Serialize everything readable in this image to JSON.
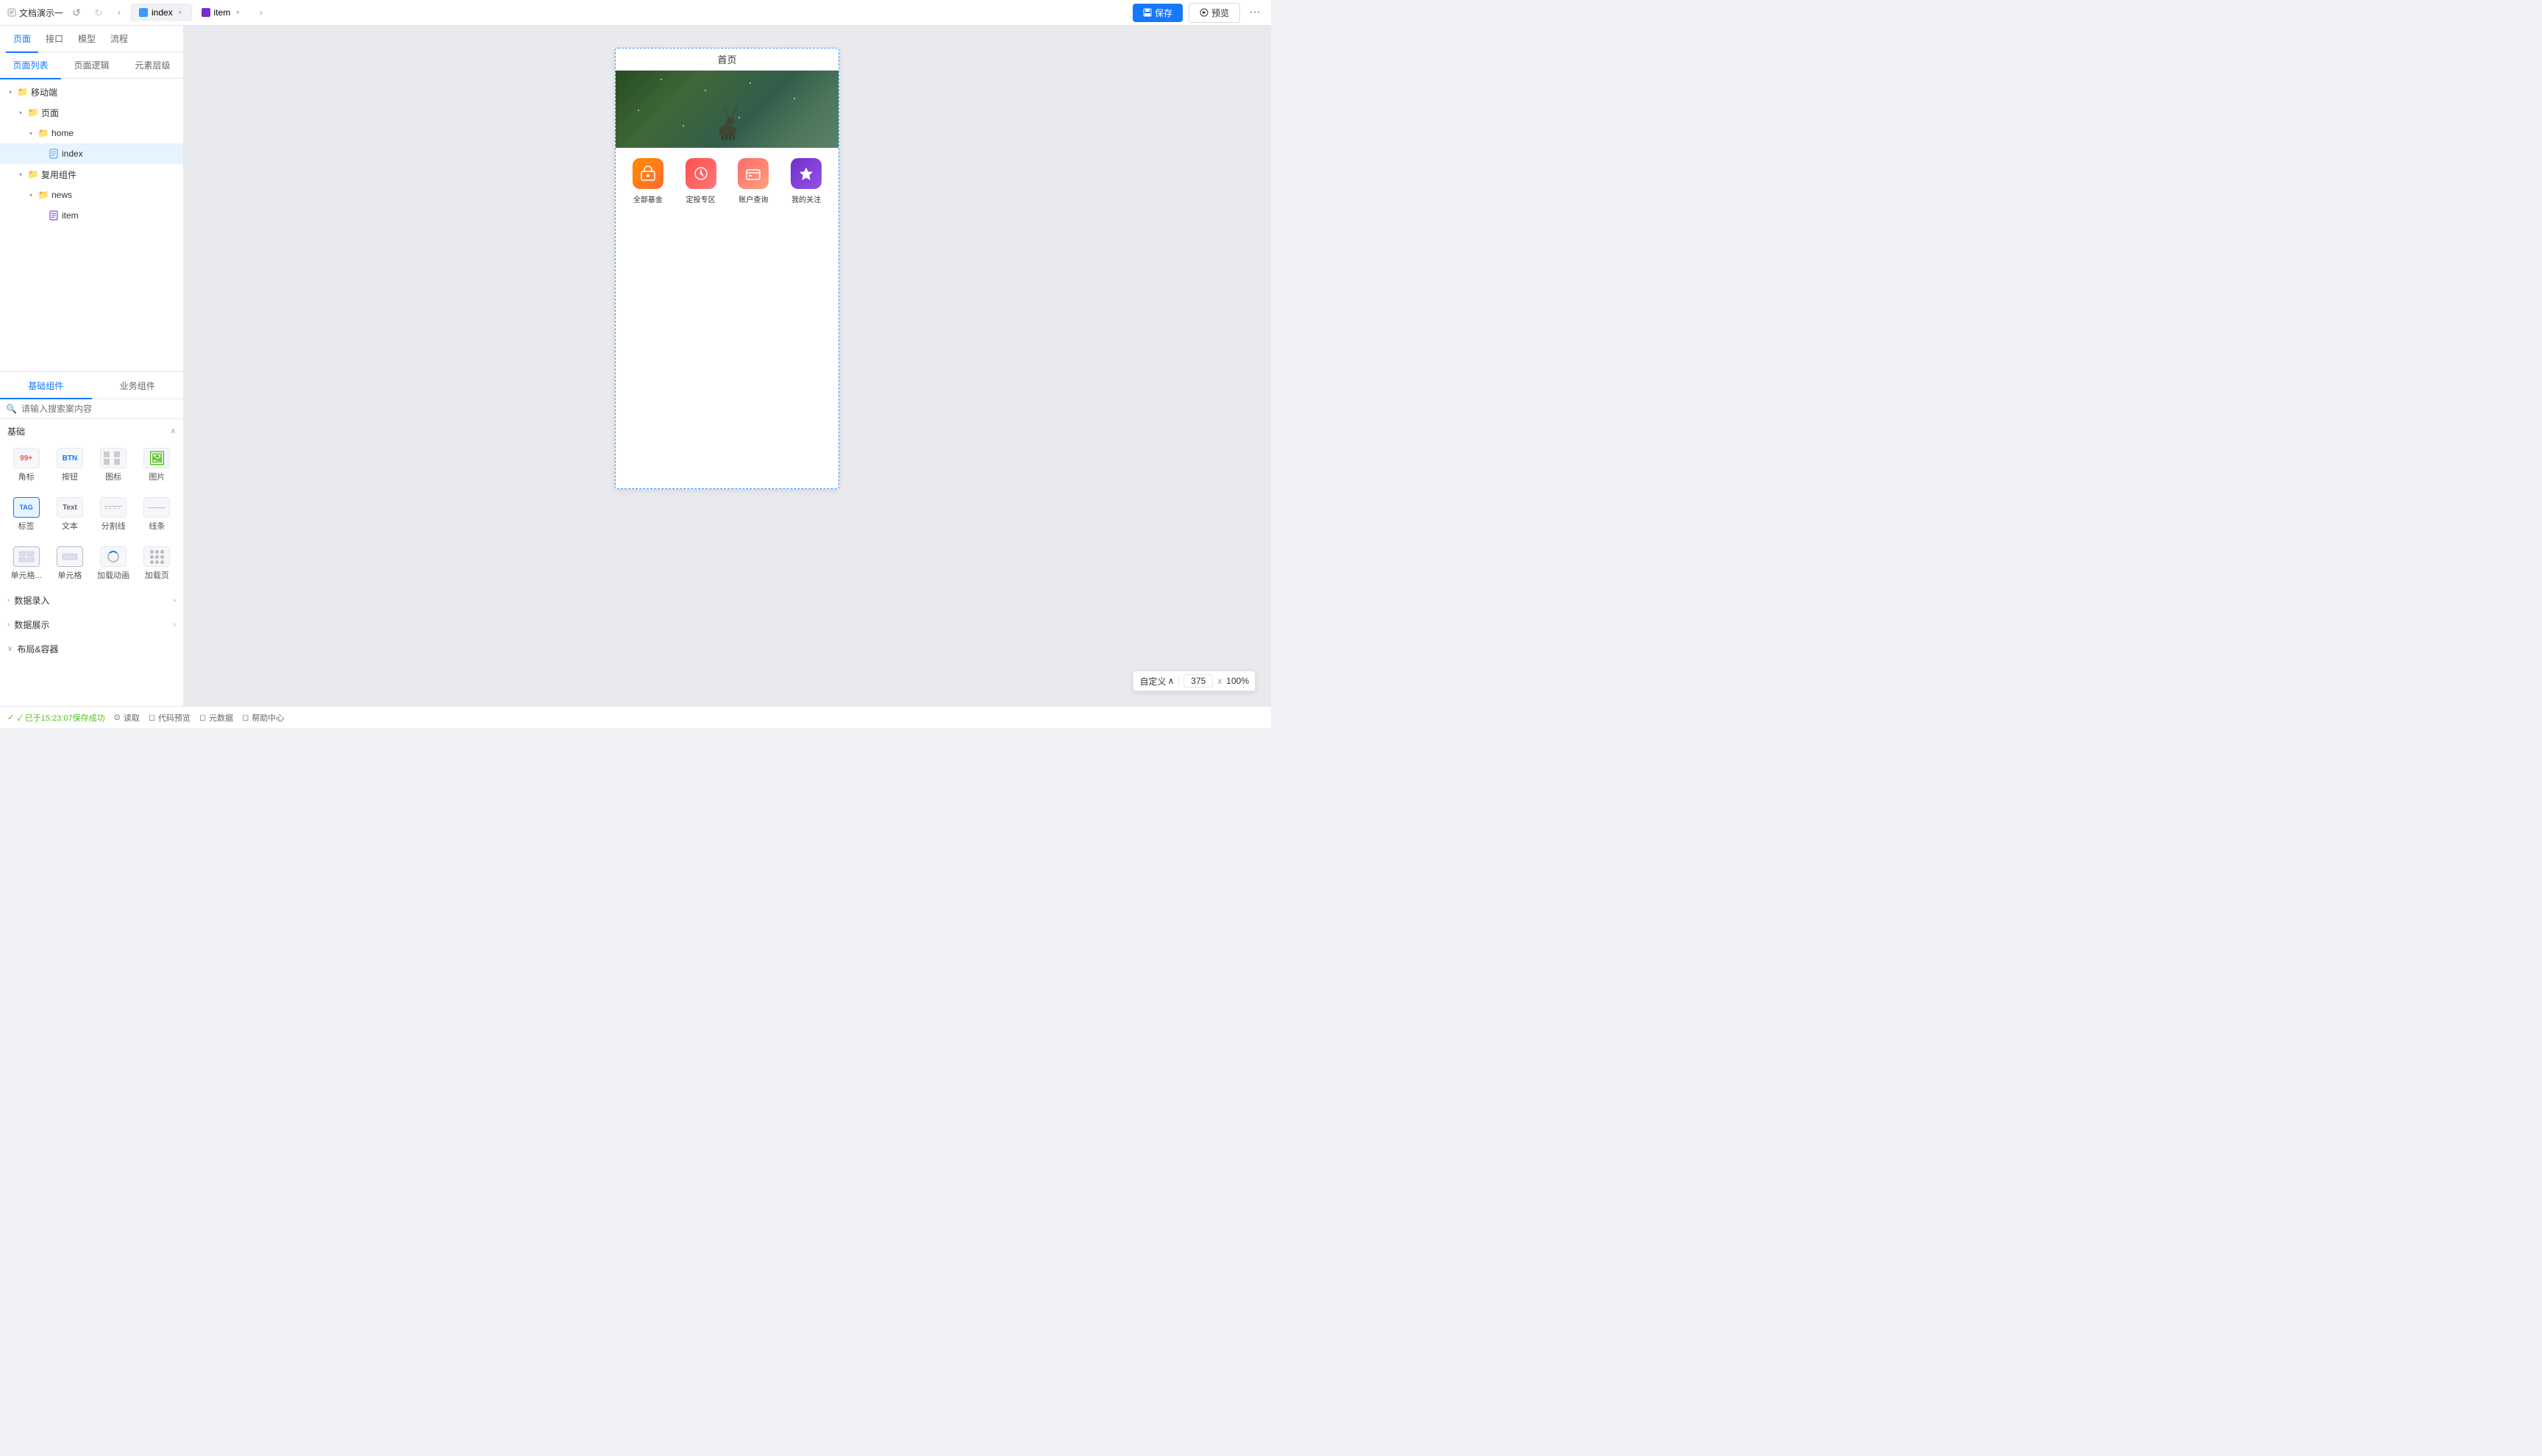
{
  "topbar": {
    "doc_title": "文档演示一",
    "back_icon": "◁",
    "undo_icon": "↺",
    "redo_icon": "↻",
    "nav_left_icon": "‹",
    "nav_right_icon": "›",
    "tabs": [
      {
        "id": "index",
        "label": "index",
        "icon_color": "blue",
        "active": true
      },
      {
        "id": "item",
        "label": "item",
        "icon_color": "purple",
        "active": false
      }
    ],
    "expand_icon": "›",
    "save_label": "保存",
    "preview_label": "预览",
    "more_icon": "···"
  },
  "left_panel": {
    "sub_nav": [
      {
        "id": "page",
        "label": "页面",
        "active": true
      },
      {
        "id": "interface",
        "label": "接口",
        "active": false
      },
      {
        "id": "model",
        "label": "模型",
        "active": false
      },
      {
        "id": "flow",
        "label": "流程",
        "active": false
      }
    ],
    "page_tabs": [
      {
        "id": "list",
        "label": "页面列表",
        "active": true
      },
      {
        "id": "logic",
        "label": "页面逻辑",
        "active": false
      },
      {
        "id": "layers",
        "label": "元素层级",
        "active": false
      }
    ],
    "file_tree": {
      "items": [
        {
          "id": "mobile",
          "label": "移动端",
          "type": "folder",
          "level": 0,
          "expanded": true,
          "arrow": "▾"
        },
        {
          "id": "pages",
          "label": "页面",
          "type": "folder",
          "level": 1,
          "expanded": true,
          "arrow": "▾"
        },
        {
          "id": "home",
          "label": "home",
          "type": "folder",
          "level": 2,
          "expanded": true,
          "arrow": "▾"
        },
        {
          "id": "index",
          "label": "index",
          "type": "page",
          "level": 3,
          "selected": true,
          "more": "···"
        },
        {
          "id": "reusable",
          "label": "复用组件",
          "type": "folder",
          "level": 1,
          "expanded": true,
          "arrow": "▾"
        },
        {
          "id": "news",
          "label": "news",
          "type": "folder",
          "level": 2,
          "expanded": true,
          "arrow": "▾"
        },
        {
          "id": "item",
          "label": "item",
          "type": "page",
          "level": 3
        }
      ]
    },
    "component_tabs": [
      {
        "id": "basic",
        "label": "基础组件",
        "active": true
      },
      {
        "id": "business",
        "label": "业务组件",
        "active": false
      }
    ],
    "search_placeholder": "请输入搜索案内容",
    "sections": [
      {
        "id": "basic",
        "label": "基础",
        "expanded": true,
        "toggle": "∧",
        "items": [
          {
            "id": "badge",
            "label": "角标",
            "icon_type": "badge",
            "icon_text": "99+"
          },
          {
            "id": "button",
            "label": "按钮",
            "icon_type": "btn",
            "icon_text": "BTN"
          },
          {
            "id": "icon",
            "label": "图标",
            "icon_type": "icon-grid"
          },
          {
            "id": "image",
            "label": "图片",
            "icon_type": "image",
            "icon_text": "🖼"
          },
          {
            "id": "tag",
            "label": "标签",
            "icon_type": "tag",
            "icon_text": "TAG"
          },
          {
            "id": "text",
            "label": "文本",
            "icon_type": "text",
            "icon_text": "Text"
          },
          {
            "id": "divider",
            "label": "分割线",
            "icon_type": "divider"
          },
          {
            "id": "line",
            "label": "线条",
            "icon_type": "line"
          }
        ]
      },
      {
        "id": "row1",
        "label": "",
        "items": [
          {
            "id": "single-grid",
            "label": "单元格...",
            "icon_type": "single-grid",
            "icon_text": ""
          },
          {
            "id": "single-row",
            "label": "单元格",
            "icon_type": "single-row",
            "icon_text": ""
          },
          {
            "id": "load-anim",
            "label": "加载动画",
            "icon_type": "load-anim"
          },
          {
            "id": "load-more",
            "label": "加载页",
            "icon_type": "load-more"
          }
        ]
      },
      {
        "id": "data-entry",
        "label": "数据录入",
        "expandable": true,
        "right_arrow": "›"
      },
      {
        "id": "data-display",
        "label": "数据展示",
        "expandable": true,
        "right_arrow": "›"
      },
      {
        "id": "layout",
        "label": "布局&容器",
        "expandable": true,
        "toggle": "∨"
      }
    ]
  },
  "canvas": {
    "phone": {
      "title": "首页",
      "hero_alt": "forest deer snow scene",
      "icons": [
        {
          "id": "all-funds",
          "label": "全部基金",
          "emoji": "📊",
          "color_class": "icon-orange"
        },
        {
          "id": "fixed-invest",
          "label": "定投专区",
          "emoji": "⏰",
          "color_class": "icon-red"
        },
        {
          "id": "account",
          "label": "账户查询",
          "emoji": "💳",
          "color_class": "icon-coral"
        },
        {
          "id": "my-follow",
          "label": "我的关注",
          "emoji": "⭐",
          "color_class": "icon-purple"
        }
      ]
    }
  },
  "zoom_controls": {
    "mode_label": "自定义",
    "dropdown_icon": "∧",
    "value": "375",
    "multiplier": "x",
    "percent": "100%"
  },
  "status_bar": {
    "save_status": "✓ 已于15:23:07保存成功",
    "read_label": "读取",
    "read_icon": "⊙",
    "code_preview_label": "代码预览",
    "code_icon": "◻",
    "meta_data_label": "元数据",
    "meta_icon": "◻",
    "help_label": "帮助中心",
    "help_icon": "◻"
  }
}
